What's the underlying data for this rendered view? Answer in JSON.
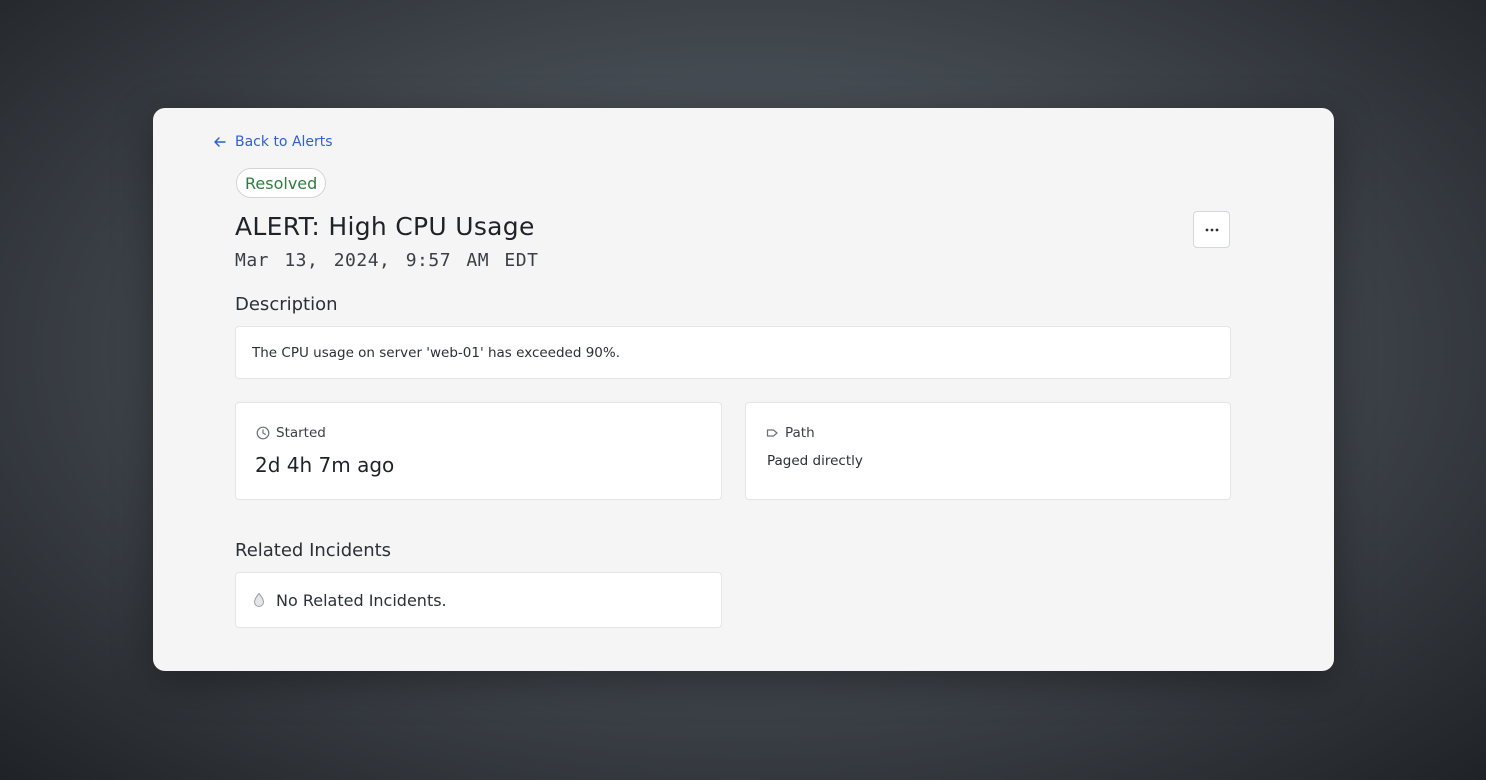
{
  "nav": {
    "back_label": "Back to Alerts",
    "back_icon": "arrow-left-icon"
  },
  "alert": {
    "status": "Resolved",
    "status_color": "#2e7d40",
    "title": "ALERT: High CPU Usage",
    "timestamp": "Mar 13, 2024, 9:57 AM EDT",
    "menu_icon": "more-horizontal-icon"
  },
  "description": {
    "heading": "Description",
    "text": "The CPU usage on server 'web-01' has exceeded 90%."
  },
  "started": {
    "label": "Started",
    "icon": "clock-icon",
    "value": "2d 4h 7m ago"
  },
  "path": {
    "label": "Path",
    "icon": "tag-arrow-icon",
    "value": "Paged directly"
  },
  "related": {
    "heading": "Related Incidents",
    "empty_text": "No Related Incidents.",
    "empty_icon": "droplet-icon"
  },
  "colors": {
    "accent": "#2f5fd0",
    "card_bg": "#f5f5f6"
  }
}
